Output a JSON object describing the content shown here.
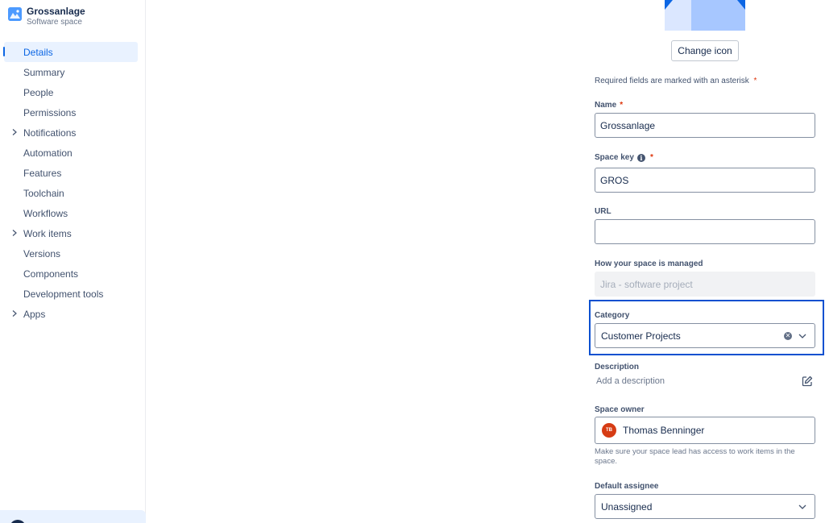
{
  "space": {
    "name": "Grossanlage",
    "type": "Software space"
  },
  "sidebar": {
    "items": [
      {
        "label": "Details",
        "active": true,
        "expandable": false
      },
      {
        "label": "Summary",
        "active": false,
        "expandable": false
      },
      {
        "label": "People",
        "active": false,
        "expandable": false
      },
      {
        "label": "Permissions",
        "active": false,
        "expandable": false
      },
      {
        "label": "Notifications",
        "active": false,
        "expandable": true
      },
      {
        "label": "Automation",
        "active": false,
        "expandable": false
      },
      {
        "label": "Features",
        "active": false,
        "expandable": false
      },
      {
        "label": "Toolchain",
        "active": false,
        "expandable": false
      },
      {
        "label": "Workflows",
        "active": false,
        "expandable": false
      },
      {
        "label": "Work items",
        "active": false,
        "expandable": true
      },
      {
        "label": "Versions",
        "active": false,
        "expandable": false
      },
      {
        "label": "Components",
        "active": false,
        "expandable": false
      },
      {
        "label": "Development tools",
        "active": false,
        "expandable": false
      },
      {
        "label": "Apps",
        "active": false,
        "expandable": true
      }
    ]
  },
  "form": {
    "change_icon_label": "Change icon",
    "required_note": "Required fields are marked with an asterisk",
    "asterisk": "*",
    "name": {
      "label": "Name",
      "value": "Grossanlage"
    },
    "space_key": {
      "label": "Space key",
      "value": "GROS"
    },
    "url": {
      "label": "URL",
      "value": ""
    },
    "managed": {
      "label": "How your space is managed",
      "value": "Jira - software project"
    },
    "category": {
      "label": "Category",
      "value": "Customer Projects"
    },
    "description": {
      "label": "Description",
      "placeholder": "Add a description"
    },
    "space_owner": {
      "label": "Space owner",
      "initials": "TB",
      "name": "Thomas Benninger",
      "helper": "Make sure your space lead has access to work items in the space."
    },
    "default_assignee": {
      "label": "Default assignee",
      "value": "Unassigned"
    }
  },
  "colors": {
    "accent": "#0c66e4",
    "highlight_border": "#0b50d0",
    "required": "#de350b",
    "owner_avatar": "#d63c14"
  }
}
